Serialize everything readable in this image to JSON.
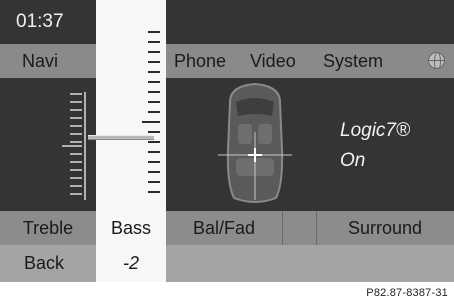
{
  "status": {
    "clock": "01:37"
  },
  "main_menu": {
    "navi": "Navi",
    "phone": "Phone",
    "video": "Video",
    "system": "System",
    "globe_icon": "globe-icon"
  },
  "sound": {
    "mode": "Logic7®",
    "mode_state": "On"
  },
  "bass_slider": {
    "value_label": "-2"
  },
  "tabs": {
    "treble": "Treble",
    "bass": "Bass",
    "bal_fad": "Bal/Fad",
    "surround": "Surround"
  },
  "bottom": {
    "back": "Back"
  },
  "footer": {
    "reference": "P82.87-8387-31"
  },
  "colors": {
    "screen_dark": "#343434",
    "bar_gray": "#8a8a8a",
    "panel_white": "#f7f7f7"
  }
}
